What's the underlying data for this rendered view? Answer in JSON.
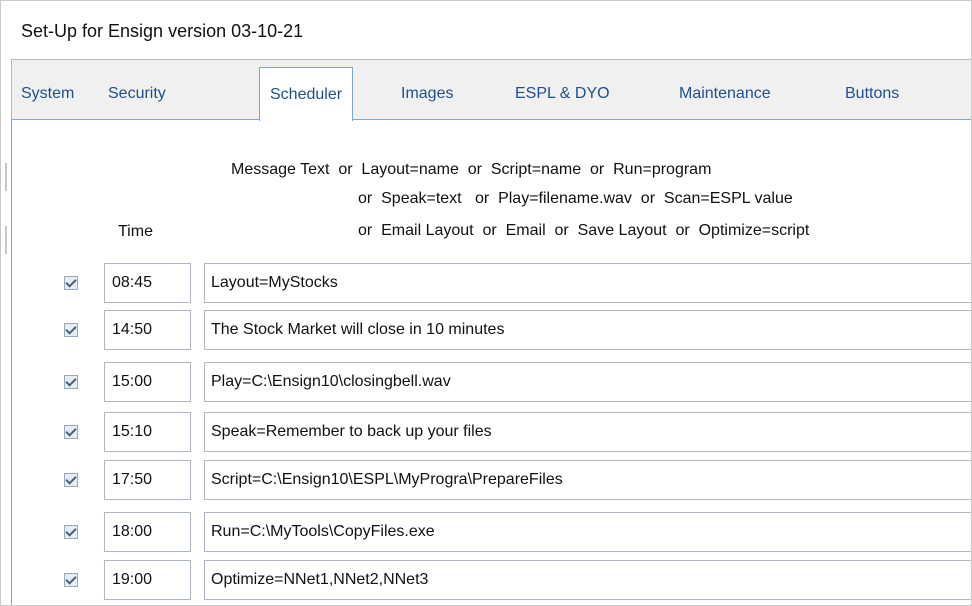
{
  "window": {
    "title": "Set-Up for Ensign version 03-10-21"
  },
  "tabs": [
    {
      "label": "System"
    },
    {
      "label": "Security"
    },
    {
      "label": "Scheduler"
    },
    {
      "label": "Images"
    },
    {
      "label": "ESPL & DYO"
    },
    {
      "label": "Maintenance"
    },
    {
      "label": "Buttons"
    }
  ],
  "scheduler": {
    "header_time": "Time",
    "header_message": [
      "Message Text  or  Layout=name  or  Script=name  or  Run=program",
      "or  Speak=text   or  Play=filename.wav  or  Scan=ESPL value",
      "or  Email Layout  or  Email  or  Save Layout  or  Optimize=script"
    ],
    "rows": [
      {
        "checked": true,
        "time": "08:45",
        "message": "Layout=MyStocks"
      },
      {
        "checked": true,
        "time": "14:50",
        "message": "The Stock Market will close in 10 minutes"
      },
      {
        "checked": true,
        "time": "15:00",
        "message": "Play=C:\\Ensign10\\closingbell.wav"
      },
      {
        "checked": true,
        "time": "15:10",
        "message": "Speak=Remember to back up your files"
      },
      {
        "checked": true,
        "time": "17:50",
        "message": "Script=C:\\Ensign10\\ESPL\\MyProgra\\PrepareFiles"
      },
      {
        "checked": true,
        "time": "18:00",
        "message": "Run=C:\\MyTools\\CopyFiles.exe"
      },
      {
        "checked": true,
        "time": "19:00",
        "message": "Optimize=NNet1,NNet2,NNet3"
      }
    ]
  },
  "colors": {
    "tab_text": "#1f4f8a",
    "active_tab_border": "#7aa7d8",
    "field_border": "#aeb7c2"
  }
}
